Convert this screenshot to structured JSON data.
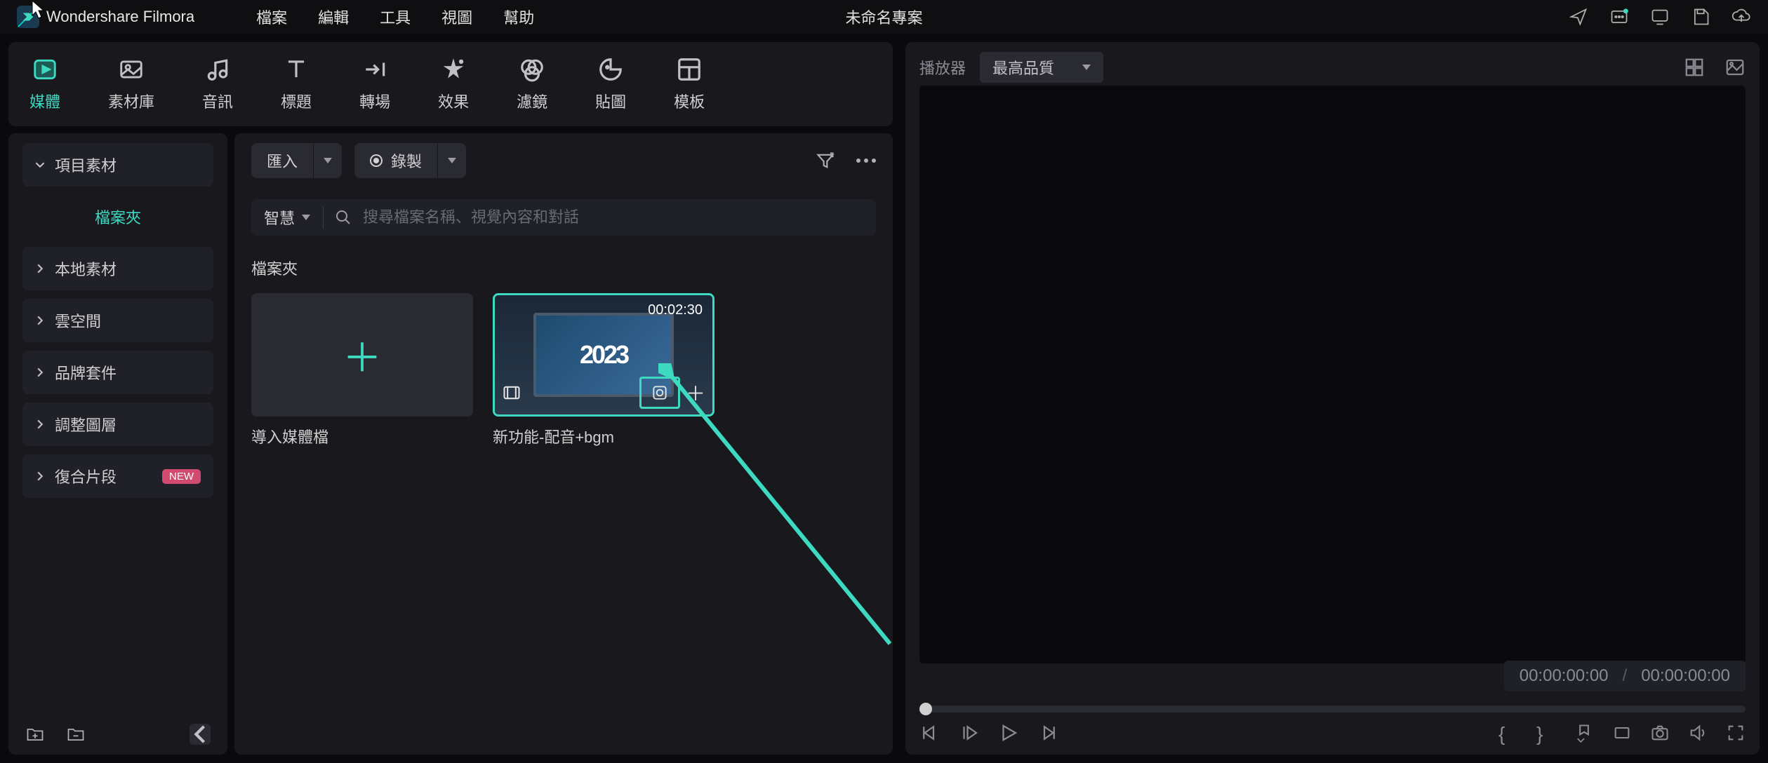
{
  "app": {
    "name": "Wondershare Filmora"
  },
  "menu": {
    "file": "檔案",
    "edit": "編輯",
    "tools": "工具",
    "view": "視圖",
    "help": "幫助"
  },
  "project": {
    "title": "未命名專案"
  },
  "tabs": {
    "media": "媒體",
    "stock": "素材庫",
    "audio": "音訊",
    "title": "標題",
    "transition": "轉場",
    "effect": "效果",
    "filter": "濾鏡",
    "sticker": "貼圖",
    "template": "模板"
  },
  "sidebar": {
    "project_media": "項目素材",
    "folder_filter": "檔案夾",
    "local": "本地素材",
    "cloud": "雲空間",
    "brand": "品牌套件",
    "adjust": "調整圖層",
    "compound": "復合片段",
    "new_badge": "NEW"
  },
  "media": {
    "import": "匯入",
    "record": "錄製",
    "smart": "智慧",
    "search_placeholder": "搜尋檔案名稱、視覺內容和對話",
    "section": "檔案夾",
    "import_card": "導入媒體檔",
    "clip_name": "新功能-配音+bgm",
    "clip_time": "00:02:30",
    "clip_year": "2023"
  },
  "player": {
    "label": "播放器",
    "quality": "最高品質",
    "time_current": "00:00:00:00",
    "time_total": "00:00:00:00"
  }
}
